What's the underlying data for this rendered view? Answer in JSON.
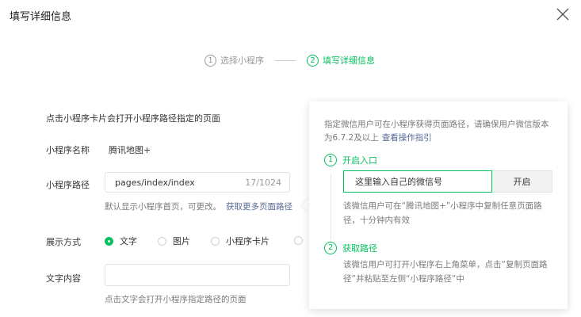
{
  "dialog": {
    "title": "填写详细信息"
  },
  "steps": [
    {
      "num": "1",
      "label": "选择小程序"
    },
    {
      "num": "2",
      "label": "填写详细信息"
    }
  ],
  "form": {
    "description": "点击小程序卡片会打开小程序路径指定的页面",
    "name_label": "小程序名称",
    "name_value": "腾讯地图+",
    "path_label": "小程序路径",
    "path_value": "pages/index/index",
    "path_count": "17/1024",
    "path_hint": "默认显示小程序首页，可更改。",
    "path_link": "获取更多页面路径",
    "display_label": "展示方式",
    "display_options": [
      "文字",
      "图片",
      "小程序卡片"
    ],
    "text_label": "文字内容",
    "text_value": "",
    "text_hint": "点击文字会打开小程序指定路径的页面"
  },
  "popover": {
    "intro": "指定微信用户可在小程序获得页面路径，请确保用户微信版本为6.7.2及以上",
    "intro_link": "查看操作指引",
    "step1": {
      "num": "1",
      "title": "开启入口",
      "input_value": "这里输入自己的微信号",
      "button": "开启",
      "desc": "该微信用户可在“腾讯地图+”小程序中复制任意页面路径，十分钟内有效"
    },
    "step2": {
      "num": "2",
      "title": "获取路径",
      "desc": "该微信用户可打开小程序右上角菜单，点击“复制页面路径”并粘贴至左侧“小程序路径”中"
    }
  },
  "colors": {
    "accent": "#07c160",
    "link": "#576b95"
  }
}
